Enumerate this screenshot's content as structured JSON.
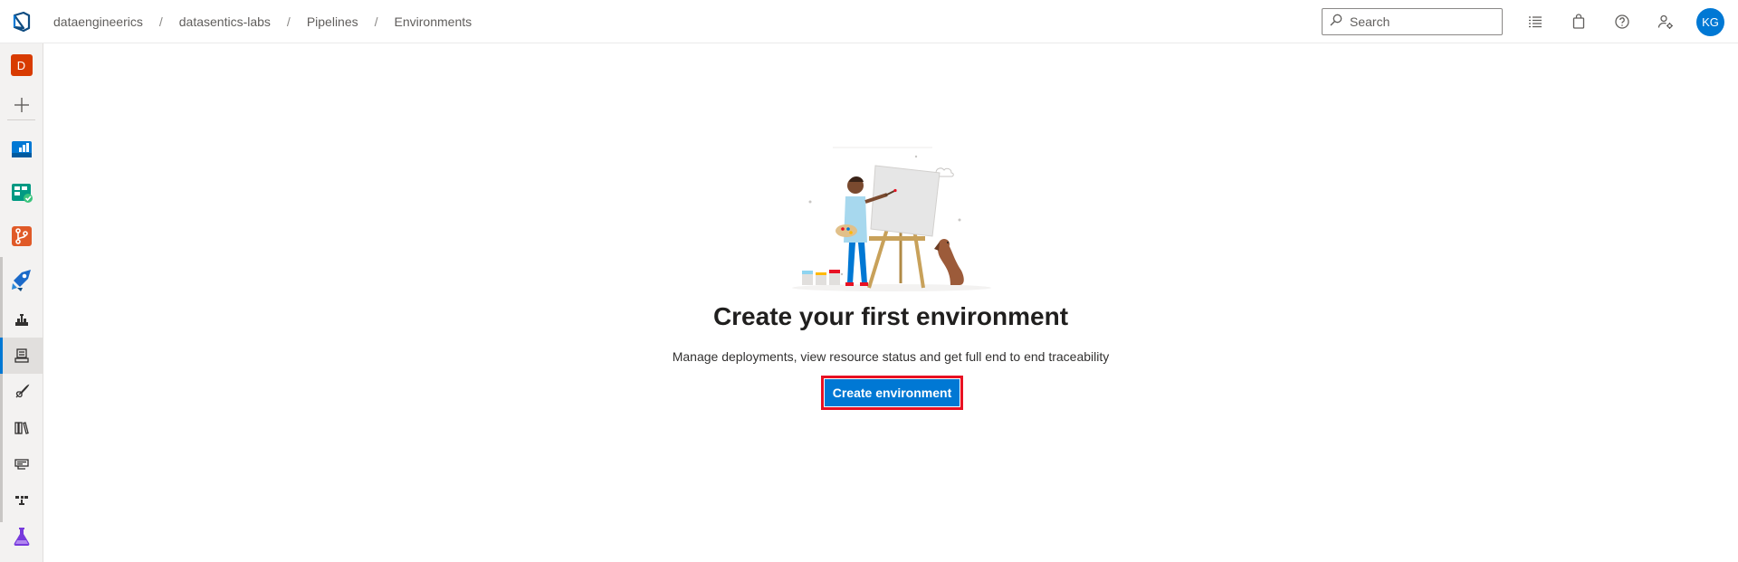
{
  "colors": {
    "accent": "#0078d4",
    "highlight": "#e81123",
    "org_badge": "#d83b01"
  },
  "header": {
    "breadcrumb": [
      "dataengineerics",
      "datasentics-labs",
      "Pipelines",
      "Environments"
    ],
    "separator": "/",
    "search_placeholder": "Search",
    "icons": [
      "ado-logo-icon",
      "task-list-icon",
      "shopping-bag-icon",
      "help-icon",
      "user-settings-icon"
    ],
    "avatar_initials": "KG"
  },
  "sidebar": {
    "org_initial": "D",
    "items": [
      {
        "icon": "org-badge-icon"
      },
      {
        "icon": "plus-icon"
      },
      {
        "icon": "overview-icon"
      },
      {
        "icon": "boards-icon"
      },
      {
        "icon": "repos-icon"
      },
      {
        "icon": "pipelines-icon"
      },
      {
        "icon": "pipelines-list-icon"
      },
      {
        "icon": "environments-icon",
        "selected": true
      },
      {
        "icon": "releases-icon"
      },
      {
        "icon": "library-icon"
      },
      {
        "icon": "task-groups-icon"
      },
      {
        "icon": "deployment-groups-icon"
      },
      {
        "icon": "test-plans-icon"
      }
    ]
  },
  "main": {
    "title": "Create your first environment",
    "subtitle": "Manage deployments, view resource status and get full end to end traceability",
    "cta_label": "Create environment",
    "illustration": "painter-with-easel-and-dog"
  }
}
